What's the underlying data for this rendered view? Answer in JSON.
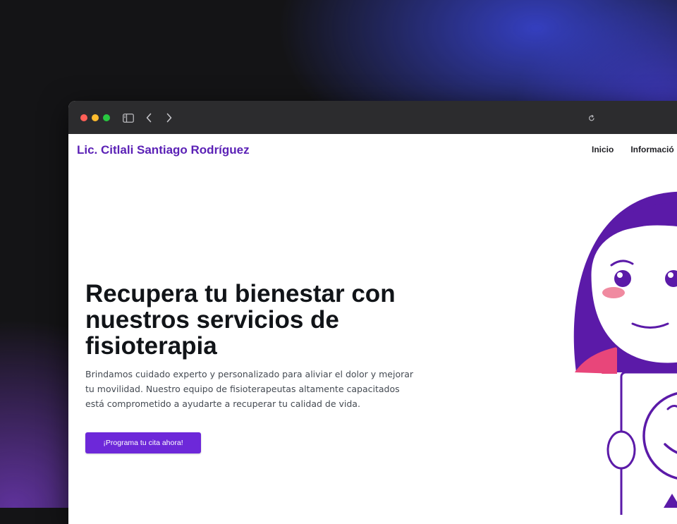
{
  "browser": {
    "icons": {
      "close": "close-dot",
      "minimize": "minimize-dot",
      "zoom": "zoom-dot",
      "sidebar": "sidebar-toggle-icon",
      "back": "chevron-left-icon",
      "forward": "chevron-right-icon",
      "reload": "reload-icon"
    }
  },
  "header": {
    "brand": "Lic. Citlali Santiago Rodríguez",
    "nav": [
      "Inicio",
      "Informació"
    ]
  },
  "hero": {
    "title": "Recupera tu bienestar con nuestros servicios de fisioterapia",
    "description": "Brindamos cuidado experto y personalizado para aliviar el dolor y mejorar tu movilidad. Nuestro equipo de fisioterapeutas altamente capacitados está comprometido a ayudarte a recuperar tu calidad de vida.",
    "cta": "¡Programa tu cita ahora!"
  },
  "colors": {
    "brand": "#5b21b6",
    "cta": "#6d28d9",
    "illustration_purple": "#5b1aa8",
    "illustration_pink": "#e8467a"
  }
}
